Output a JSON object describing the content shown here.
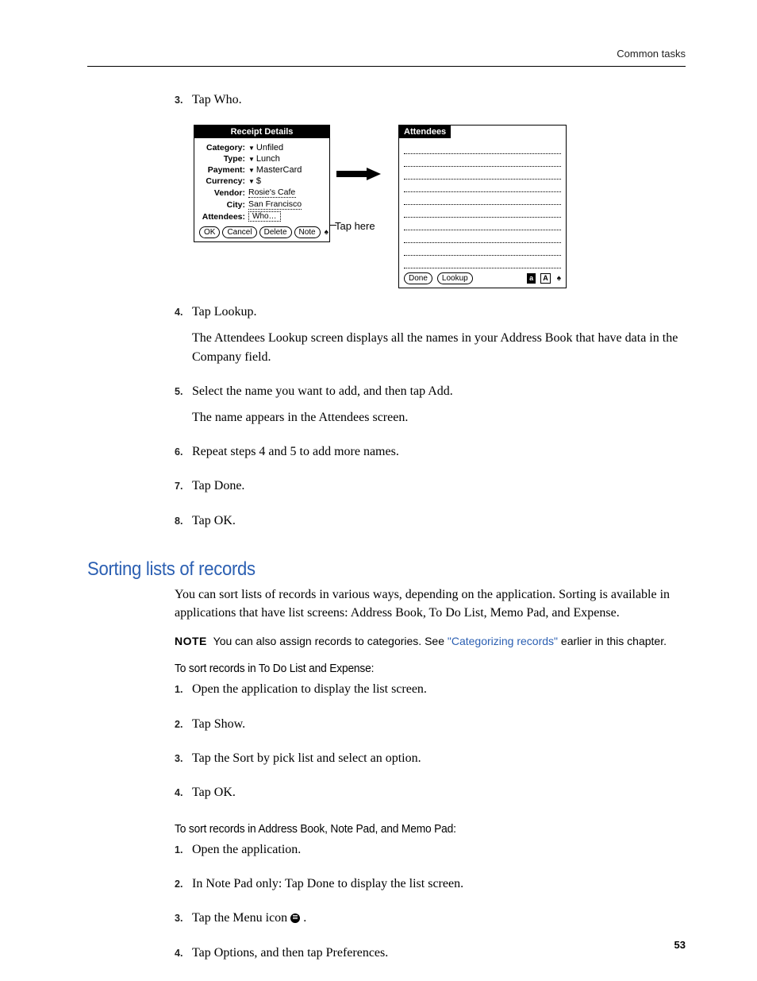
{
  "header": {
    "right": "Common tasks",
    "page_number": "53"
  },
  "stepsA": {
    "s3": {
      "num": "3.",
      "text": "Tap Who."
    },
    "s4": {
      "num": "4.",
      "text": "Tap Lookup.",
      "para": "The Attendees Lookup screen displays all the names in your Address Book that have data in the Company field."
    },
    "s5": {
      "num": "5.",
      "text": "Select the name you want to add, and then tap Add.",
      "para": "The name appears in the Attendees screen."
    },
    "s6": {
      "num": "6.",
      "text": "Repeat steps 4 and 5 to add more names."
    },
    "s7": {
      "num": "7.",
      "text": "Tap Done."
    },
    "s8": {
      "num": "8.",
      "text": "Tap OK."
    }
  },
  "figure": {
    "receipt_title": "Receipt Details",
    "row_category": {
      "label": "Category:",
      "value": "Unfiled"
    },
    "row_type": {
      "label": "Type:",
      "value": "Lunch"
    },
    "row_payment": {
      "label": "Payment:",
      "value": "MasterCard"
    },
    "row_currency": {
      "label": "Currency:",
      "value": "$"
    },
    "row_vendor": {
      "label": "Vendor:",
      "value": "Rosie's Cafe"
    },
    "row_city": {
      "label": "City:",
      "value": "San Francisco"
    },
    "row_attendees": {
      "label": "Attendees:",
      "value": "Who…"
    },
    "btn_ok": "OK",
    "btn_cancel": "Cancel",
    "btn_delete": "Delete",
    "btn_note": "Note",
    "tap_here": "Tap here",
    "attendees_title": "Attendees",
    "btn_done": "Done",
    "btn_lookup": "Lookup",
    "abc_a": "a",
    "abc_A": "A"
  },
  "section_heading": "Sorting lists of records",
  "section_para": "You can sort lists of records in various ways, depending on the application. Sorting is available in applications that have list screens: Address Book, To Do List, Memo Pad, and Expense.",
  "note": {
    "label": "NOTE",
    "before_link": "You can also assign records to categories. See ",
    "link": "\"Categorizing records\"",
    "after_link": " earlier in this chapter."
  },
  "subheadB": "To sort records in To Do List and Expense:",
  "stepsB": {
    "s1": {
      "num": "1.",
      "text": "Open the application to display the list screen."
    },
    "s2": {
      "num": "2.",
      "text": "Tap Show."
    },
    "s3": {
      "num": "3.",
      "text": "Tap the Sort by pick list and select an option."
    },
    "s4": {
      "num": "4.",
      "text": "Tap OK."
    }
  },
  "subheadC": "To sort records in Address Book, Note Pad, and Memo Pad:",
  "stepsC": {
    "s1": {
      "num": "1.",
      "text": "Open the application."
    },
    "s2": {
      "num": "2.",
      "text": "In Note Pad only: Tap Done to display the list screen."
    },
    "s3": {
      "num": "3.",
      "before": "Tap the Menu icon ",
      "after": " ."
    },
    "s4": {
      "num": "4.",
      "text": "Tap Options, and then tap Preferences."
    }
  }
}
